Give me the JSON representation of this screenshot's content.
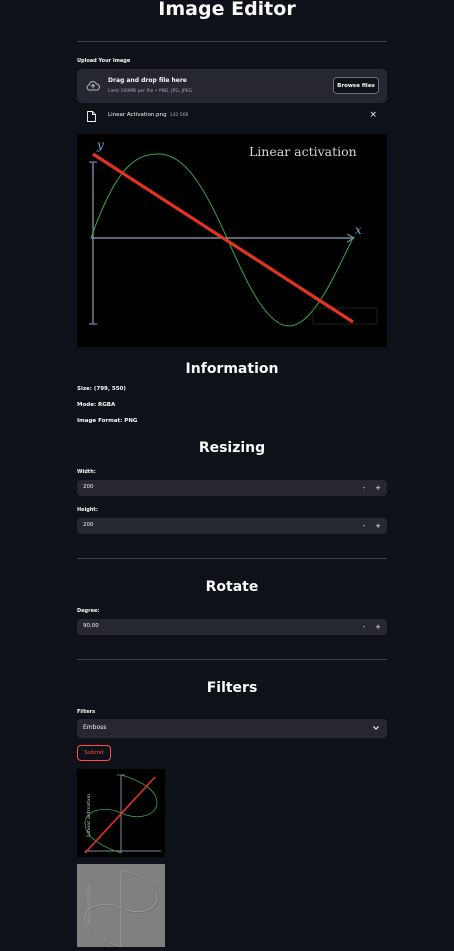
{
  "app": {
    "title": "Image Editor"
  },
  "uploader": {
    "label": "Upload Your Image",
    "drag_text": "Drag and drop file here",
    "limit_text": "Limit 200MB per file • PNG, JPG, JPEG",
    "browse_label": "Browse files"
  },
  "file": {
    "name": "Linear Activation.png",
    "size": "142.5KB",
    "close_glyph": "×"
  },
  "main_image": {
    "title": "Linear activation",
    "y_axis_letter": "y",
    "x_axis_letter": "x",
    "line_color": "#e53321",
    "curve_color": "#3fa34d",
    "axis_color": "#7a8aa0"
  },
  "information": {
    "heading": "Information",
    "size": "Size: (799, 550)",
    "mode": "Mode: RGBA",
    "format": "Image Format: PNG"
  },
  "resizing": {
    "heading": "Resizing",
    "width_label": "Width:",
    "width_value": "200",
    "height_label": "Height:",
    "height_value": "200"
  },
  "rotate": {
    "heading": "Rotate",
    "degree_label": "Degree:",
    "degree_value": "90.00"
  },
  "stepper": {
    "minus": "-",
    "plus": "+"
  },
  "filters": {
    "heading": "Filters",
    "label": "Filters",
    "selected": "Emboss",
    "submit_label": "Submit"
  },
  "thumbnails": {
    "rotated_title": "Linear activation",
    "emboss_title": "Linear activation"
  },
  "colors": {
    "background": "#0e1117",
    "widget": "#262730",
    "accent": "#ff4b4b"
  }
}
